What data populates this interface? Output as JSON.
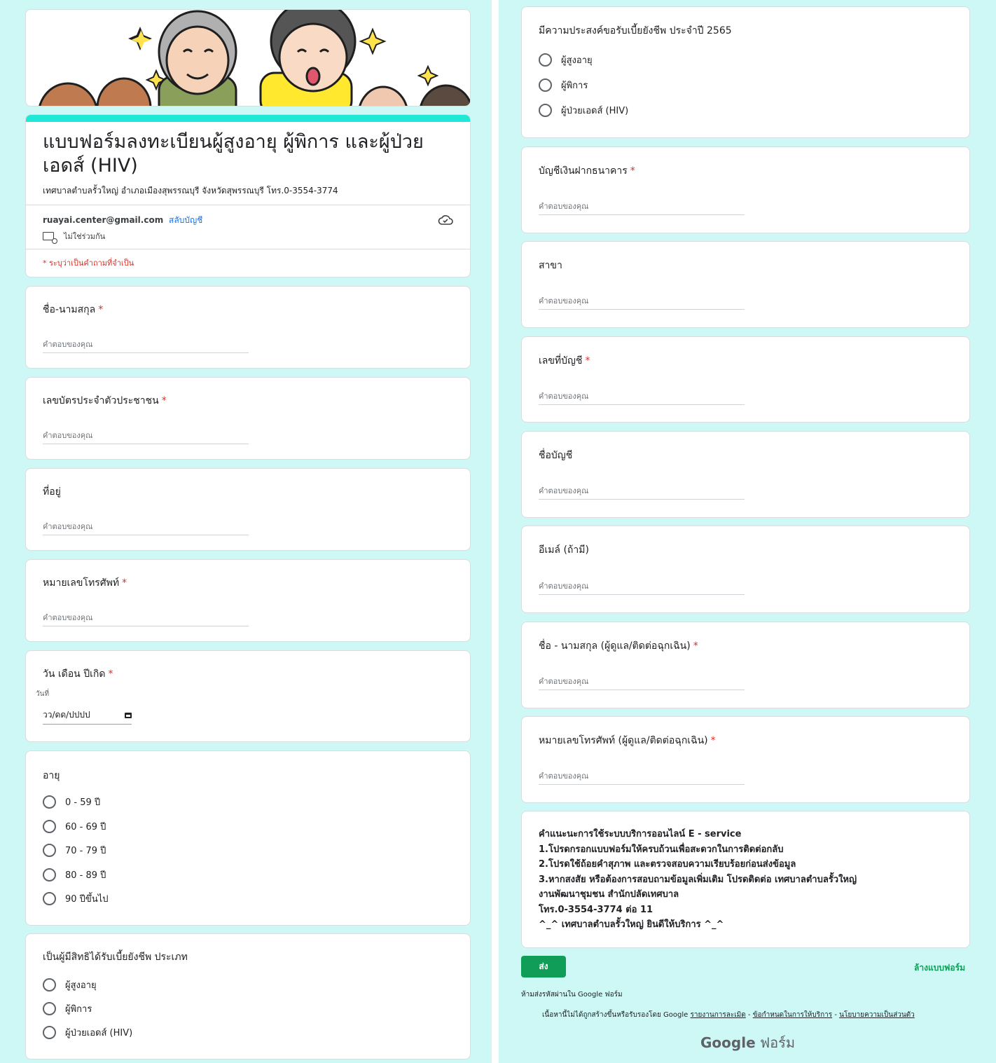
{
  "header": {
    "title": "แบบฟอร์มลงทะเบียนผู้สูงอายุ ผู้พิการ และผู้ป่วยเอดส์ (HIV)",
    "description": "เทศบาลตำบลรั้วใหญ่ อำเภอเมืองสุพรรณบุรี จังหวัดสุพรรณบุรี โทร.0-3554-3774",
    "account_email": "ruayai.center@gmail.com",
    "switch_account": "สลับบัญชี",
    "not_shared": "ไม่ใช่ร่วมกัน",
    "required_note": "* ระบุว่าเป็นคำถามที่จำเป็น",
    "accent_color": "#1de9d6"
  },
  "placeholder": "คำตอบของคุณ",
  "questions": {
    "name": {
      "label": "ชื่อ-นามสกุล",
      "required": "*"
    },
    "id_card": {
      "label": "เลขบัตรประจำตัวประชาชน",
      "required": "*"
    },
    "address": {
      "label": "ที่อยู่"
    },
    "phone": {
      "label": "หมายเลขโทรศัพท์",
      "required": "*"
    },
    "birth": {
      "label": "วัน เดือน ปีเกิด",
      "required": "*",
      "unit": "วันที่",
      "placeholder": "วว/ดด/ปปปป"
    },
    "age": {
      "label": "อายุ",
      "options": [
        "0 - 59 ปี",
        "60 - 69 ปี",
        "70 - 79 ปี",
        "80 - 89 ปี",
        "90 ปีขึ้นไป"
      ]
    },
    "entitled": {
      "label": "เป็นผู้มีสิทธิได้รับเบี้ยยังชีพ ประเภท",
      "options": [
        "ผู้สูงอายุ",
        "ผู้พิการ",
        "ผู้ป่วยเอดส์ (HIV)"
      ]
    },
    "wish": {
      "label": "มีความประสงค์ขอรับเบี้ยยังชีพ ประจำปี 2565",
      "options": [
        "ผู้สูงอายุ",
        "ผู้พิการ",
        "ผู้ป่วยเอดส์ (HIV)"
      ]
    },
    "bank": {
      "label": "บัญชีเงินฝากธนาคาร",
      "required": "*"
    },
    "branch": {
      "label": "สาขา"
    },
    "account_no": {
      "label": "เลขที่บัญชี",
      "required": "*"
    },
    "account_name": {
      "label": "ชื่อบัญชี"
    },
    "email": {
      "label": "อีเมล์ (ถ้ามี)"
    },
    "caregiver_name": {
      "label": "ชื่อ - นามสกุล (ผู้ดูแล/ติดต่อฉุกเฉิน)",
      "required": "*"
    },
    "caregiver_phone": {
      "label": "หมายเลขโทรศัพท์ (ผู้ดูแล/ติดต่อฉุกเฉิน)",
      "required": "*"
    }
  },
  "instructions": [
    "คำแนะนะการใช้ระบบบริการออนไลน์ E - service",
    "1.โปรดกรอกแบบฟอร์มให้ครบถ้วนเพื่อสะดวกในการติดต่อกลับ",
    "2.โปรดใช้ถ้อยคำสุภาพ และตรวจสอบความเรียบร้อยก่อนส่งข้อมูล",
    "3.หากสงสัย หรือต้องการสอบถามข้อมูลเพิ่มเติม โปรดติดต่อ เทศบาลตำบลรั้วใหญ่",
    "งานพัฒนาชุมชน สำนักปลัดเทศบาล",
    "โทร.0-3554-3774 ต่อ 11",
    "^_^ เทศบาลตำบลรั้วใหญ่ ยินดีให้บริการ ^_^"
  ],
  "footer": {
    "submit": "ส่ง",
    "clear": "ล้างแบบฟอร์ม",
    "password_warning": "ห้ามส่งรหัสผ่านใน Google ฟอร์ม",
    "disclaimer": "เนื้อหานี้ไม่ได้ถูกสร้างขึ้นหรือรับรองโดย Google",
    "report_abuse": "รายงานการละเมิด",
    "terms": "ข้อกำหนดในการให้บริการ",
    "privacy": "นโยบายความเป็นส่วนตัว",
    "separator": " - ",
    "logo_google": "Google",
    "logo_forms": "ฟอร์ม",
    "submit_color": "#0f9d58"
  }
}
